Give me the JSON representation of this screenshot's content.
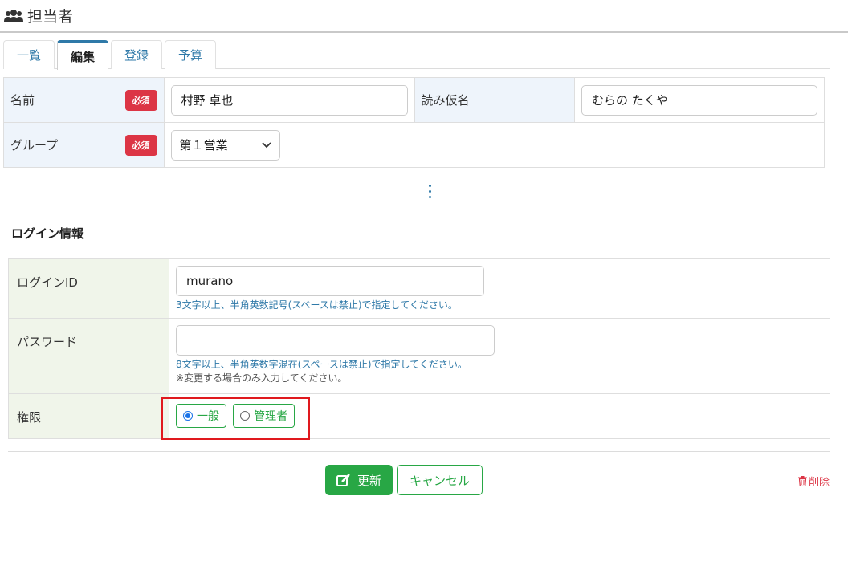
{
  "header": {
    "title": "担当者"
  },
  "tabs": [
    {
      "label": "一覧"
    },
    {
      "label": "編集"
    },
    {
      "label": "登録"
    },
    {
      "label": "予算"
    }
  ],
  "basic": {
    "required_label": "必須",
    "name_label": "名前",
    "name_value": "村野 卓也",
    "kana_label": "読み仮名",
    "kana_value": "むらの たくや",
    "group_label": "グループ",
    "group_value": "第１営業"
  },
  "login": {
    "section_title": "ログイン情報",
    "id_label": "ログインID",
    "id_value": "murano",
    "id_help": "3文字以上、半角英数記号(スペースは禁止)で指定してください。",
    "pw_label": "パスワード",
    "pw_value": "",
    "pw_help": "8文字以上、半角英数字混在(スペースは禁止)で指定してください。",
    "pw_help2": "※変更する場合のみ入力してください。",
    "role_label": "権限",
    "role_options": [
      {
        "label": "一般",
        "selected": true
      },
      {
        "label": "管理者",
        "selected": false
      }
    ]
  },
  "actions": {
    "update_label": "更新",
    "cancel_label": "キャンセル",
    "delete_label": "削除"
  },
  "colors": {
    "accent": "#2f79a8",
    "success": "#28a745",
    "danger": "#dc3545",
    "highlight": "#e0191e"
  }
}
